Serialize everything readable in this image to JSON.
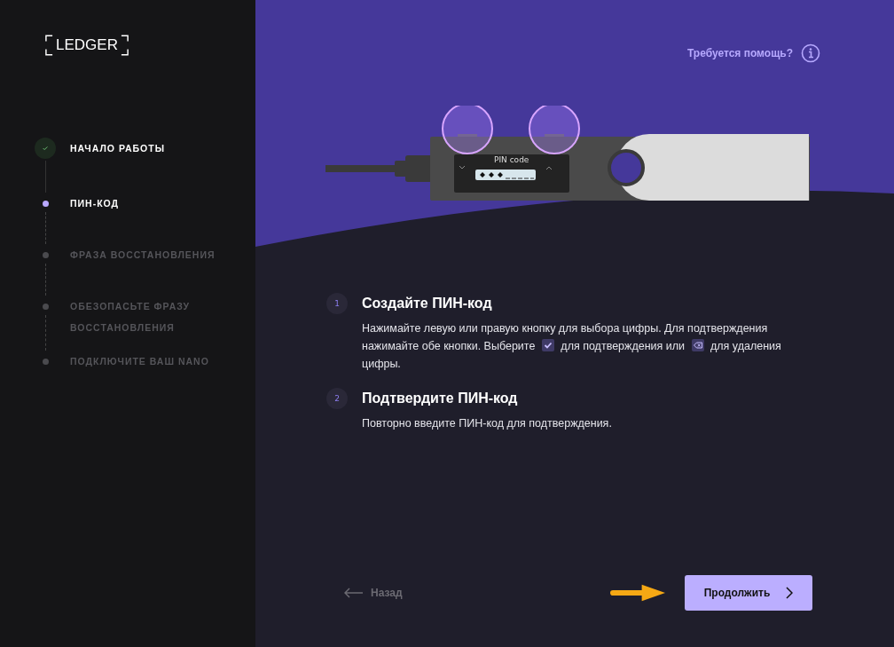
{
  "logo": {
    "text": "LEDGER"
  },
  "steps": [
    {
      "label": "НАЧАЛО РАБОТЫ",
      "completed": true,
      "selected": false
    },
    {
      "label": "ПИН-КОД",
      "completed": false,
      "selected": true
    },
    {
      "label": "ФРАЗА ВОССТАНОВЛЕНИЯ",
      "completed": false,
      "selected": false
    },
    {
      "label": "ОБЕЗОПАСЬТЕ ФРАЗУ ВОССТАНОВЛЕНИЯ",
      "completed": false,
      "selected": false
    },
    {
      "label": "ПОДКЛЮЧИТЕ ВАШ NANO",
      "completed": false,
      "selected": false
    }
  ],
  "help_link": "Требуется помощь?",
  "device": {
    "screen_title": "PIN code"
  },
  "instructions": [
    {
      "number": "1",
      "title": "Создайте ПИН-код",
      "parts": [
        {
          "kind": "text",
          "text": "Нажимайте левую или правую кнопку для выбора цифры. Для подтверждения нажимайте обе кнопки. Выберите "
        },
        {
          "kind": "check"
        },
        {
          "kind": "text",
          "text": " для подтверждения или "
        },
        {
          "kind": "erase"
        },
        {
          "kind": "text",
          "text": " для удаления цифры."
        }
      ]
    },
    {
      "number": "2",
      "title": "Подтвердите ПИН-код",
      "parts": [
        {
          "kind": "text",
          "text": "Повторно введите ПИН-код для подтверждения."
        }
      ]
    }
  ],
  "back_button": "Назад",
  "continue_button": "Продолжить"
}
